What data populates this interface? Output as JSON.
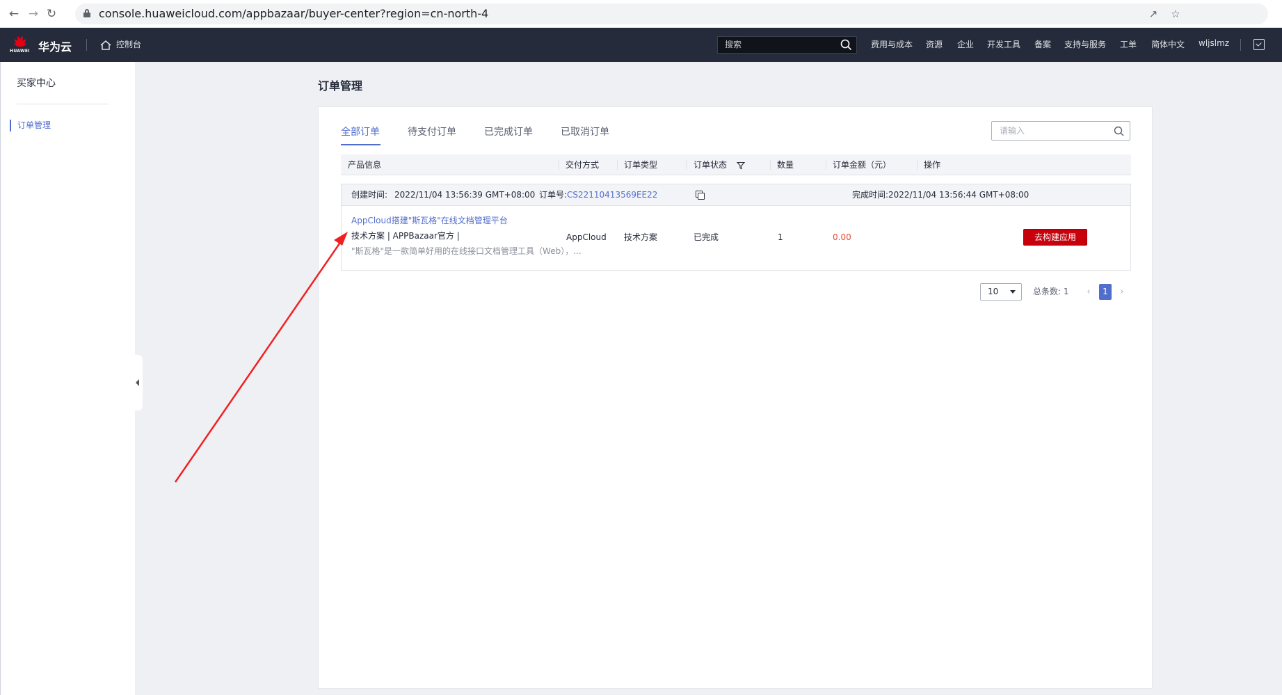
{
  "browser": {
    "url": "console.huaweicloud.com/appbazaar/buyer-center?region=cn-north-4"
  },
  "header": {
    "logo_text": "华为云",
    "logo_word": "HUAWEI",
    "console_label": "控制台",
    "search_placeholder": "搜索",
    "nav": [
      "费用与成本",
      "资源",
      "企业",
      "开发工具",
      "备案",
      "支持与服务",
      "工单",
      "简体中文",
      "wljslmz"
    ]
  },
  "sidebar": {
    "title": "买家中心",
    "items": [
      {
        "label": "订单管理",
        "active": true
      }
    ]
  },
  "page": {
    "title": "订单管理",
    "tabs": [
      {
        "label": "全部订单",
        "active": true
      },
      {
        "label": "待支付订单",
        "active": false
      },
      {
        "label": "已完成订单",
        "active": false
      },
      {
        "label": "已取消订单",
        "active": false
      }
    ],
    "search_placeholder": "请输入"
  },
  "table": {
    "columns": [
      "产品信息",
      "交付方式",
      "订单类型",
      "订单状态",
      "数量",
      "订单金额（元）",
      "操作"
    ],
    "orders": [
      {
        "created_label": "创建时间:",
        "created": "2022/11/04 13:56:39 GMT+08:00",
        "order_no_label": "订单号:",
        "order_no": "CS22110413569EE22",
        "completed_label": "完成时间:",
        "completed": "2022/11/04 13:56:44 GMT+08:00",
        "product_name": "AppCloud搭建\"斯瓦格\"在线文档管理平台",
        "product_meta": "技术方案 | APPBazaar官方 |",
        "product_desc": "\"斯瓦格\"是一款简单好用的在线接口文档管理工具（Web），...",
        "delivery": "AppCloud",
        "type": "技术方案",
        "status": "已完成",
        "quantity": "1",
        "amount": "0.00",
        "action": "去构建应用"
      }
    ]
  },
  "pagination": {
    "page_size": "10",
    "total_label": "总条数:",
    "total": "1",
    "current_page": "1"
  },
  "colors": {
    "header_bg": "#252b3a",
    "accent": "#526ecc",
    "primary_btn": "#c7000b",
    "amount": "#e64a3b",
    "annotation_arrow": "#f02020"
  }
}
